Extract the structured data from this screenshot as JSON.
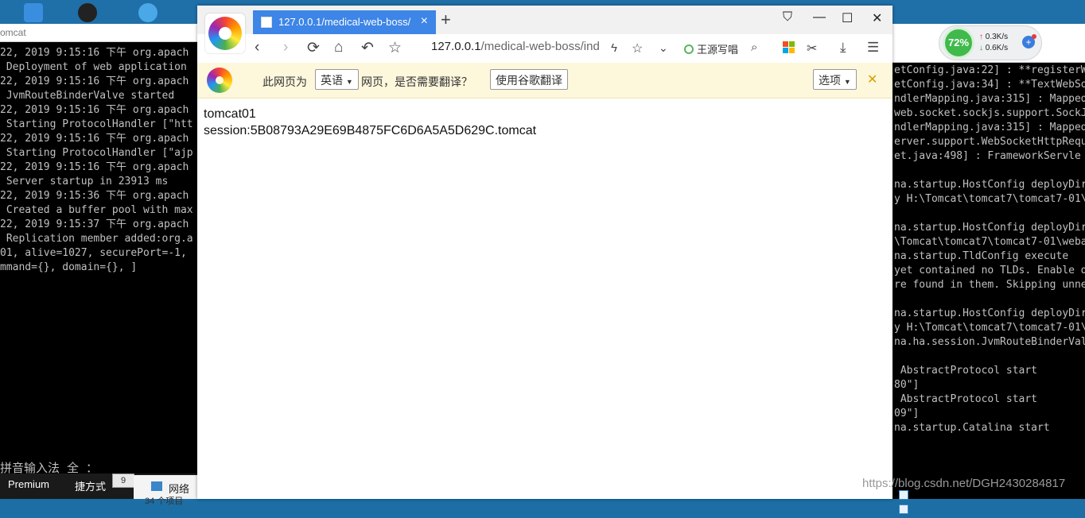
{
  "terminal_left": {
    "title": "omcat",
    "lines": [
      "22, 2019 9:15:16 下午 org.apach",
      " Deployment of web application",
      "22, 2019 9:15:16 下午 org.apach",
      " JvmRouteBinderValve started",
      "22, 2019 9:15:16 下午 org.apach",
      " Starting ProtocolHandler [\"htt",
      "22, 2019 9:15:16 下午 org.apach",
      " Starting ProtocolHandler [\"ajp",
      "22, 2019 9:15:16 下午 org.apach",
      " Server startup in 23913 ms",
      "22, 2019 9:15:36 下午 org.apach",
      " Created a buffer pool with max",
      "22, 2019 9:15:37 下午 org.apach",
      " Replication member added:org.a",
      "01, alive=1027, securePort=-1,",
      "mmand={}, domain={}, ]"
    ],
    "ime": "拼音输入法 全 ："
  },
  "terminal_right": {
    "lines": [
      "etConfig.java:22] : **registerW",
      "etConfig.java:34] : **TextWebSo",
      "ndlerMapping.java:315] : Mapped",
      "web.socket.sockjs.support.SockJ",
      "ndlerMapping.java:315] : Mapped",
      "erver.support.WebSocketHttpRequ",
      "et.java:498] : FrameworkServle",
      "",
      "na.startup.HostConfig deployDir",
      "y H:\\Tomcat\\tomcat7\\tomcat7-01\\",
      "",
      "na.startup.HostConfig deployDir",
      "\\Tomcat\\tomcat7\\tomcat7-01\\weba",
      "na.startup.TldConfig execute",
      "yet contained no TLDs. Enable d",
      "re found in them. Skipping unne",
      "",
      "na.startup.HostConfig deployDir",
      "y H:\\Tomcat\\tomcat7\\tomcat7-01\\",
      "na.ha.session.JvmRouteBinderVal",
      "",
      " AbstractProtocol start",
      "80\"]",
      " AbstractProtocol start",
      "09\"]",
      "na.startup.Catalina start"
    ]
  },
  "taskbar": {
    "premium": "Premium",
    "second": "捷方式",
    "box": "9",
    "network_label": "网络",
    "network_sub": "34 个项目"
  },
  "speed_widget": {
    "percent": "72%",
    "up": "0.3K/s",
    "down": "0.6K/s",
    "plus": "+"
  },
  "browser": {
    "tab_title": "127.0.0.1/medical-web-boss/",
    "tab_close": "×",
    "new_tab": "+",
    "address_host": "127.0.0.1",
    "address_path": "/medical-web-boss/ind",
    "search_text": "王源写唱",
    "translate": {
      "prefix": "此网页为",
      "language": "英语",
      "middle": "网页，是否需要翻译？",
      "button": "使用谷歌翻译",
      "options": "选项",
      "close": "✕"
    },
    "content": {
      "line1": "tomcat01",
      "line2": "session:5B08793A29E69B4875FC6D6A5A5D629C.tomcat"
    }
  },
  "watermark": "https://blog.csdn.net/DGH2430284817",
  "colors": {
    "tab_active": "#3d85e6",
    "translate_bg": "#fdf7dc",
    "terminal_bg": "#000000",
    "speed_green": "#3fba4b"
  }
}
